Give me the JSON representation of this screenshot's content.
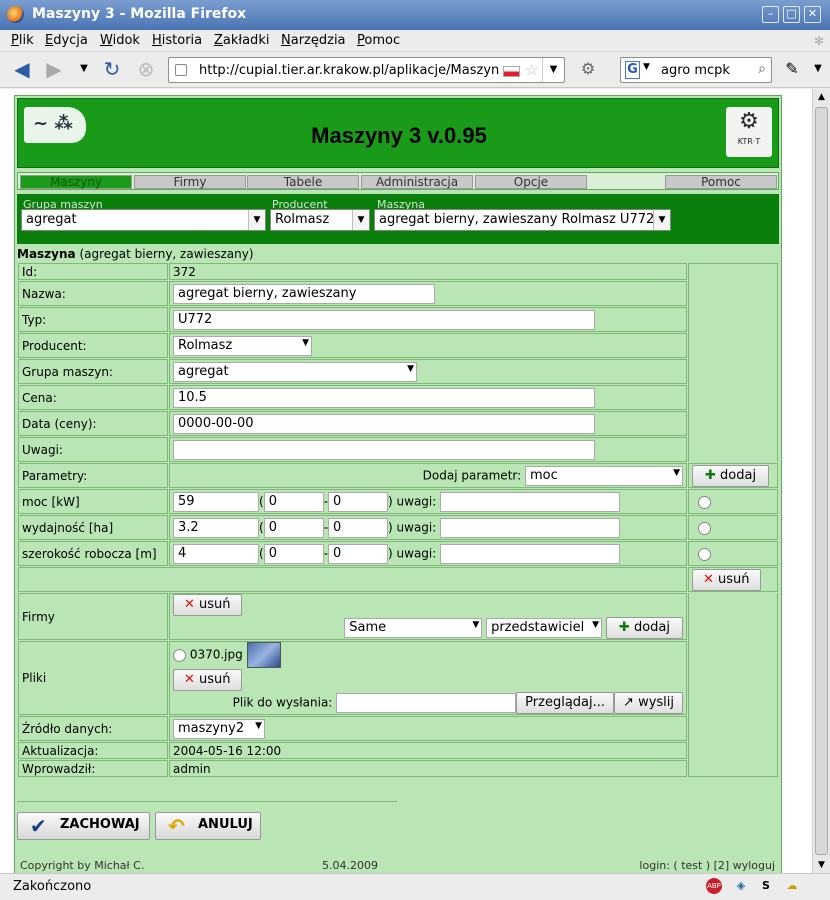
{
  "window": {
    "title": "Maszyny 3 - Mozilla Firefox"
  },
  "menu": [
    "Plik",
    "Edycja",
    "Widok",
    "Historia",
    "Zakładki",
    "Narzędzia",
    "Pomoc"
  ],
  "nav": {
    "url": "http://cupial.tier.ar.krakow.pl/aplikacje/Maszyny.",
    "search": "agro mcpk"
  },
  "app": {
    "title": "Maszyny 3 v.0.95",
    "logo_right": "KTR·T"
  },
  "tabs": [
    "Maszyny",
    "Firmy",
    "Tabele",
    "Administracja",
    "Opcje",
    "Pomoc"
  ],
  "selectors": {
    "group_label": "Grupa maszyn",
    "group_value": "agregat",
    "producer_label": "Producent",
    "producer_value": "Rolmasz",
    "machine_label": "Maszyna",
    "machine_value": "agregat bierny, zawieszany Rolmasz U772"
  },
  "section": {
    "bold": "Maszyna",
    "rest": " (agregat bierny, zawieszany)"
  },
  "form": {
    "id_label": "Id:",
    "id_value": "372",
    "name_label": "Nazwa:",
    "name_value": "agregat bierny, zawieszany",
    "type_label": "Typ:",
    "type_value": "U772",
    "producer_label": "Producent:",
    "producer_value": "Rolmasz",
    "group_label": "Grupa maszyn:",
    "group_value": "agregat",
    "price_label": "Cena:",
    "price_value": "10.5",
    "date_label": "Data (ceny):",
    "date_value": "0000-00-00",
    "notes_label": "Uwagi:",
    "notes_value": "",
    "params_label": "Parametry:",
    "add_param_label": "Dodaj parametr:",
    "add_param_value": "moc",
    "add_button": "dodaj",
    "params": [
      {
        "name": "moc [kW]",
        "value": "59",
        "min": "0",
        "max": "0",
        "notes": ""
      },
      {
        "name": "wydajność [ha]",
        "value": "3.2",
        "min": "0",
        "max": "0",
        "notes": ""
      },
      {
        "name": "szerokość robocza [m]",
        "value": "4",
        "min": "0",
        "max": "0",
        "notes": ""
      }
    ],
    "notes_word": "uwagi:",
    "remove_button": "usuń",
    "firms_label": "Firmy",
    "firm_value": "Same",
    "firm_role": "przedstawiciel",
    "files_label": "Pliki",
    "file_name": "0370.jpg",
    "upload_label": "Plik do wysłania:",
    "browse_button": "Przeglądaj...",
    "send_button": "wyslij",
    "source_label": "Źródło danych:",
    "source_value": "maszyny2",
    "updated_label": "Aktualizacja:",
    "updated_value": "2004-05-16 12:00",
    "author_label": "Wprowadził:",
    "author_value": "admin"
  },
  "actions": {
    "save": "ZACHOWAJ",
    "cancel": "ANULUJ"
  },
  "footer": {
    "copyright": "Copyright by Michał C.",
    "date": "5.04.2009",
    "login": "login: ( test ) [2] wyloguj"
  },
  "status": {
    "text": "Zakończono"
  }
}
